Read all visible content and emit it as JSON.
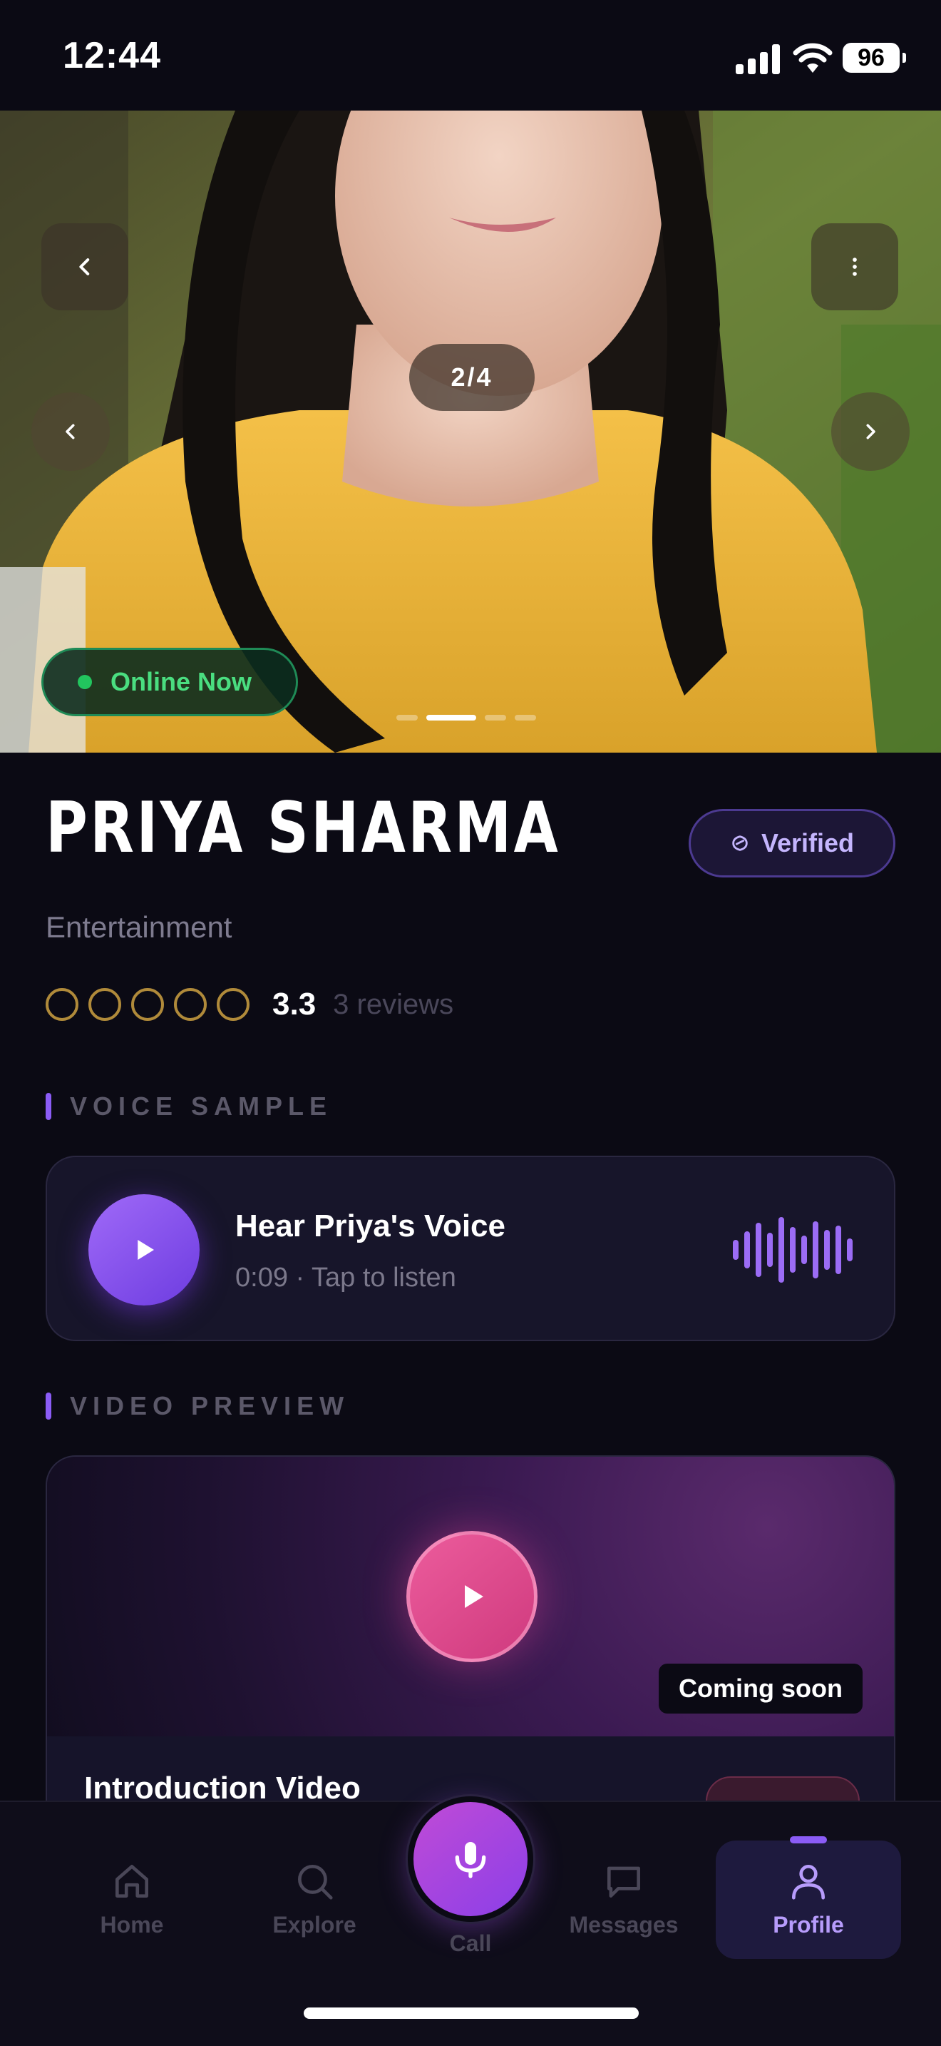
{
  "status_bar": {
    "time": "12:44",
    "battery": "96"
  },
  "hero": {
    "counter": "2/4",
    "online_status": "Online Now",
    "slides_total": 4,
    "current_slide": 2
  },
  "profile": {
    "name": "PRIYA SHARMA",
    "verified_label": "Verified",
    "category": "Entertainment",
    "rating": "3.3",
    "reviews": "3 reviews",
    "rating_stars_filled": 0,
    "rating_stars_total": 5
  },
  "voice_section": {
    "label": "VOICE SAMPLE",
    "title": "Hear Priya's Voice",
    "subtitle": "0:09 · Tap to listen"
  },
  "video_section": {
    "label": "VIDEO PREVIEW",
    "badge": "Coming soon",
    "title": "Introduction Video"
  },
  "bottom_nav": {
    "home": "Home",
    "explore": "Explore",
    "call": "Call",
    "messages": "Messages",
    "profile": "Profile",
    "active": "Profile"
  },
  "colors": {
    "background": "#0b0a14",
    "accent_purple": "#8b5cf6",
    "online_green": "#22c55e",
    "video_pink": "#ec5c9c",
    "star_gold": "#b08a3a"
  }
}
